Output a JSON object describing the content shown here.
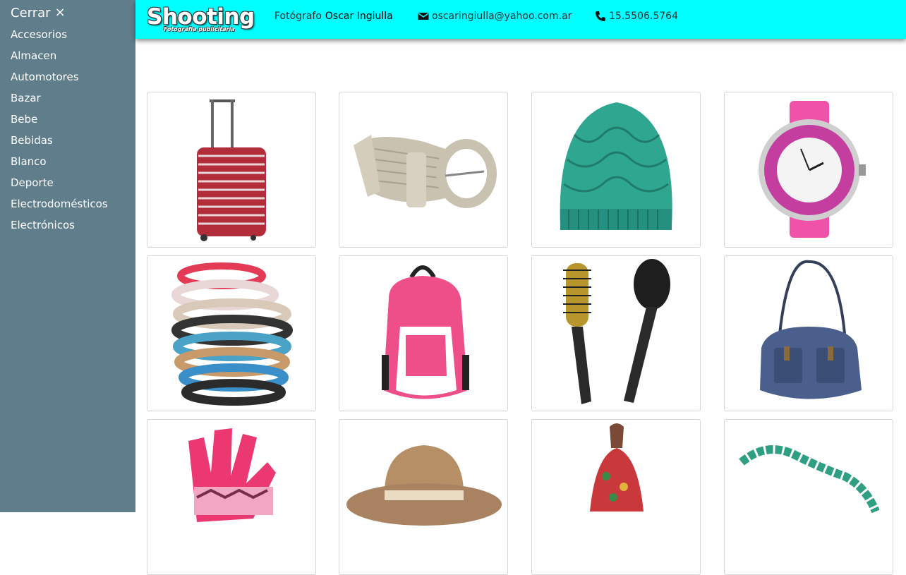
{
  "sidebar": {
    "close_label": "Cerrar",
    "close_icon": "×",
    "items": [
      {
        "label": "Accesorios"
      },
      {
        "label": "Almacen"
      },
      {
        "label": "Automotores"
      },
      {
        "label": "Bazar"
      },
      {
        "label": "Bebe"
      },
      {
        "label": "Bebidas"
      },
      {
        "label": "Blanco"
      },
      {
        "label": "Deporte"
      },
      {
        "label": "Electrodomésticos"
      },
      {
        "label": "Electrónicos"
      }
    ]
  },
  "header": {
    "logo_text": "Shooting",
    "logo_subtext": "Fotografia publicitaria",
    "photographer_label": "Fotógrafo",
    "photographer_name": "Oscar Ingiulla",
    "email": "oscaringiulla@yahoo.com.ar",
    "phone": "15.5506.5764"
  },
  "products": [
    {
      "name": "suitcase"
    },
    {
      "name": "belt"
    },
    {
      "name": "beanie"
    },
    {
      "name": "watch"
    },
    {
      "name": "bangles"
    },
    {
      "name": "backpack"
    },
    {
      "name": "hairbrushes"
    },
    {
      "name": "denim-handbag"
    },
    {
      "name": "gloves"
    },
    {
      "name": "hat"
    },
    {
      "name": "scarf-bag"
    },
    {
      "name": "bead-necklace"
    }
  ],
  "colors": {
    "sidebar_bg": "#607d8b",
    "header_bg": "#00ffff"
  }
}
